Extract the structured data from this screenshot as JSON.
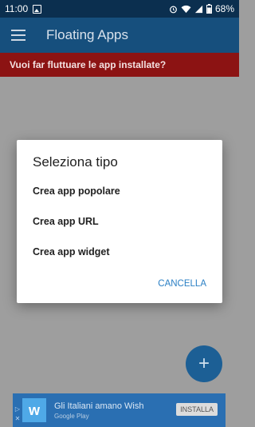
{
  "status_bar": {
    "time": "11:00",
    "battery": "68%",
    "icons": [
      "image-icon",
      "alarm-icon",
      "wifi-icon",
      "signal-icon",
      "battery-icon"
    ]
  },
  "app_bar": {
    "title": "Floating Apps",
    "menu_icon": "menu-icon"
  },
  "banner": {
    "text": "Vuoi far fluttuare le app installate?"
  },
  "dialog": {
    "title": "Seleziona tipo",
    "options": [
      "Crea app popolare",
      "Crea app URL",
      "Crea app widget"
    ],
    "cancel_label": "CANCELLA"
  },
  "fab": {
    "label": "+"
  },
  "ad": {
    "headline": "Gli Italiani amano Wish",
    "sub": "Google Play",
    "install_label": "INSTALLA",
    "logo_text": "w"
  },
  "colors": {
    "status_bar": "#0b2f4f",
    "app_bar": "#164f7d",
    "banner": "#8c1313",
    "accent": "#2a7fc4",
    "scrim": "#9e9e9e"
  }
}
